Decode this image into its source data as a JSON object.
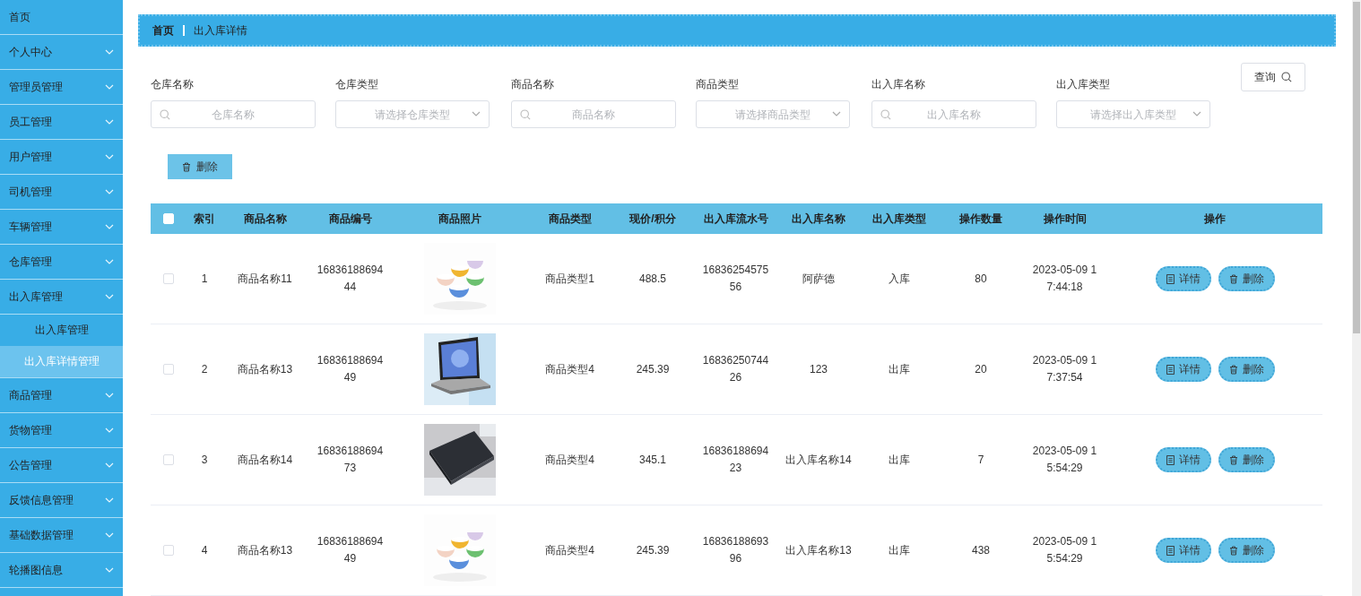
{
  "sidebar": {
    "items": [
      {
        "kind": "link",
        "label": "首页"
      },
      {
        "kind": "menu",
        "label": "个人中心"
      },
      {
        "kind": "menu",
        "label": "管理员管理"
      },
      {
        "kind": "menu",
        "label": "员工管理"
      },
      {
        "kind": "menu",
        "label": "用户管理"
      },
      {
        "kind": "menu",
        "label": "司机管理"
      },
      {
        "kind": "menu",
        "label": "车辆管理"
      },
      {
        "kind": "menu",
        "label": "仓库管理"
      },
      {
        "kind": "menu",
        "label": "出入库管理",
        "children": [
          {
            "label": "出入库管理",
            "selected": false
          },
          {
            "label": "出入库详情管理",
            "selected": true
          }
        ]
      },
      {
        "kind": "menu",
        "label": "商品管理"
      },
      {
        "kind": "menu",
        "label": "货物管理"
      },
      {
        "kind": "menu",
        "label": "公告管理"
      },
      {
        "kind": "menu",
        "label": "反馈信息管理"
      },
      {
        "kind": "menu",
        "label": "基础数据管理"
      },
      {
        "kind": "menu",
        "label": "轮播图信息"
      }
    ]
  },
  "breadcrumb": [
    "首页",
    "出入库详情"
  ],
  "filters": [
    {
      "kind": "text",
      "label": "仓库名称",
      "placeholder": "仓库名称"
    },
    {
      "kind": "select",
      "label": "仓库类型",
      "placeholder": "请选择仓库类型"
    },
    {
      "kind": "text",
      "label": "商品名称",
      "placeholder": "商品名称"
    },
    {
      "kind": "select",
      "label": "商品类型",
      "placeholder": "请选择商品类型"
    },
    {
      "kind": "text",
      "label": "出入库名称",
      "placeholder": "出入库名称"
    },
    {
      "kind": "select",
      "label": "出入库类型",
      "placeholder": "请选择出入库类型"
    }
  ],
  "search_button": "查询",
  "delete_button": "删除",
  "table": {
    "all_selected": false,
    "columns": [
      "索引",
      "商品名称",
      "商品编号",
      "商品照片",
      "商品类型",
      "现价/积分",
      "出入库流水号",
      "出入库名称",
      "出入库类型",
      "操作数量",
      "操作时间",
      "操作"
    ],
    "rows": [
      {
        "selected": false,
        "index": "1",
        "name": "商品名称11",
        "code": "1683618869444",
        "type": "商品类型1",
        "price": "488.5",
        "serial": "1683625457556",
        "io_name": "阿萨德",
        "io_type": "入库",
        "quantity": "80",
        "time": "2023-05-09 17:44:18",
        "actions": [
          "详情",
          "删除"
        ]
      },
      {
        "selected": false,
        "index": "2",
        "name": "商品名称13",
        "code": "1683618869449",
        "type": "商品类型4",
        "price": "245.39",
        "serial": "1683625074426",
        "io_name": "123",
        "io_type": "出库",
        "quantity": "20",
        "time": "2023-05-09 17:37:54",
        "actions": [
          "详情",
          "删除"
        ]
      },
      {
        "selected": false,
        "index": "3",
        "name": "商品名称14",
        "code": "1683618869473",
        "type": "商品类型4",
        "price": "345.1",
        "serial": "1683618869423",
        "io_name": "出入库名称14",
        "io_type": "出库",
        "quantity": "7",
        "time": "2023-05-09 15:54:29",
        "actions": [
          "详情",
          "删除"
        ]
      },
      {
        "selected": false,
        "index": "4",
        "name": "商品名称13",
        "code": "1683618869449",
        "type": "商品类型4",
        "price": "245.39",
        "serial": "1683618869396",
        "io_name": "出入库名称13",
        "io_type": "出库",
        "quantity": "438",
        "time": "2023-05-09 15:54:29",
        "actions": [
          "详情",
          "删除"
        ]
      }
    ]
  }
}
